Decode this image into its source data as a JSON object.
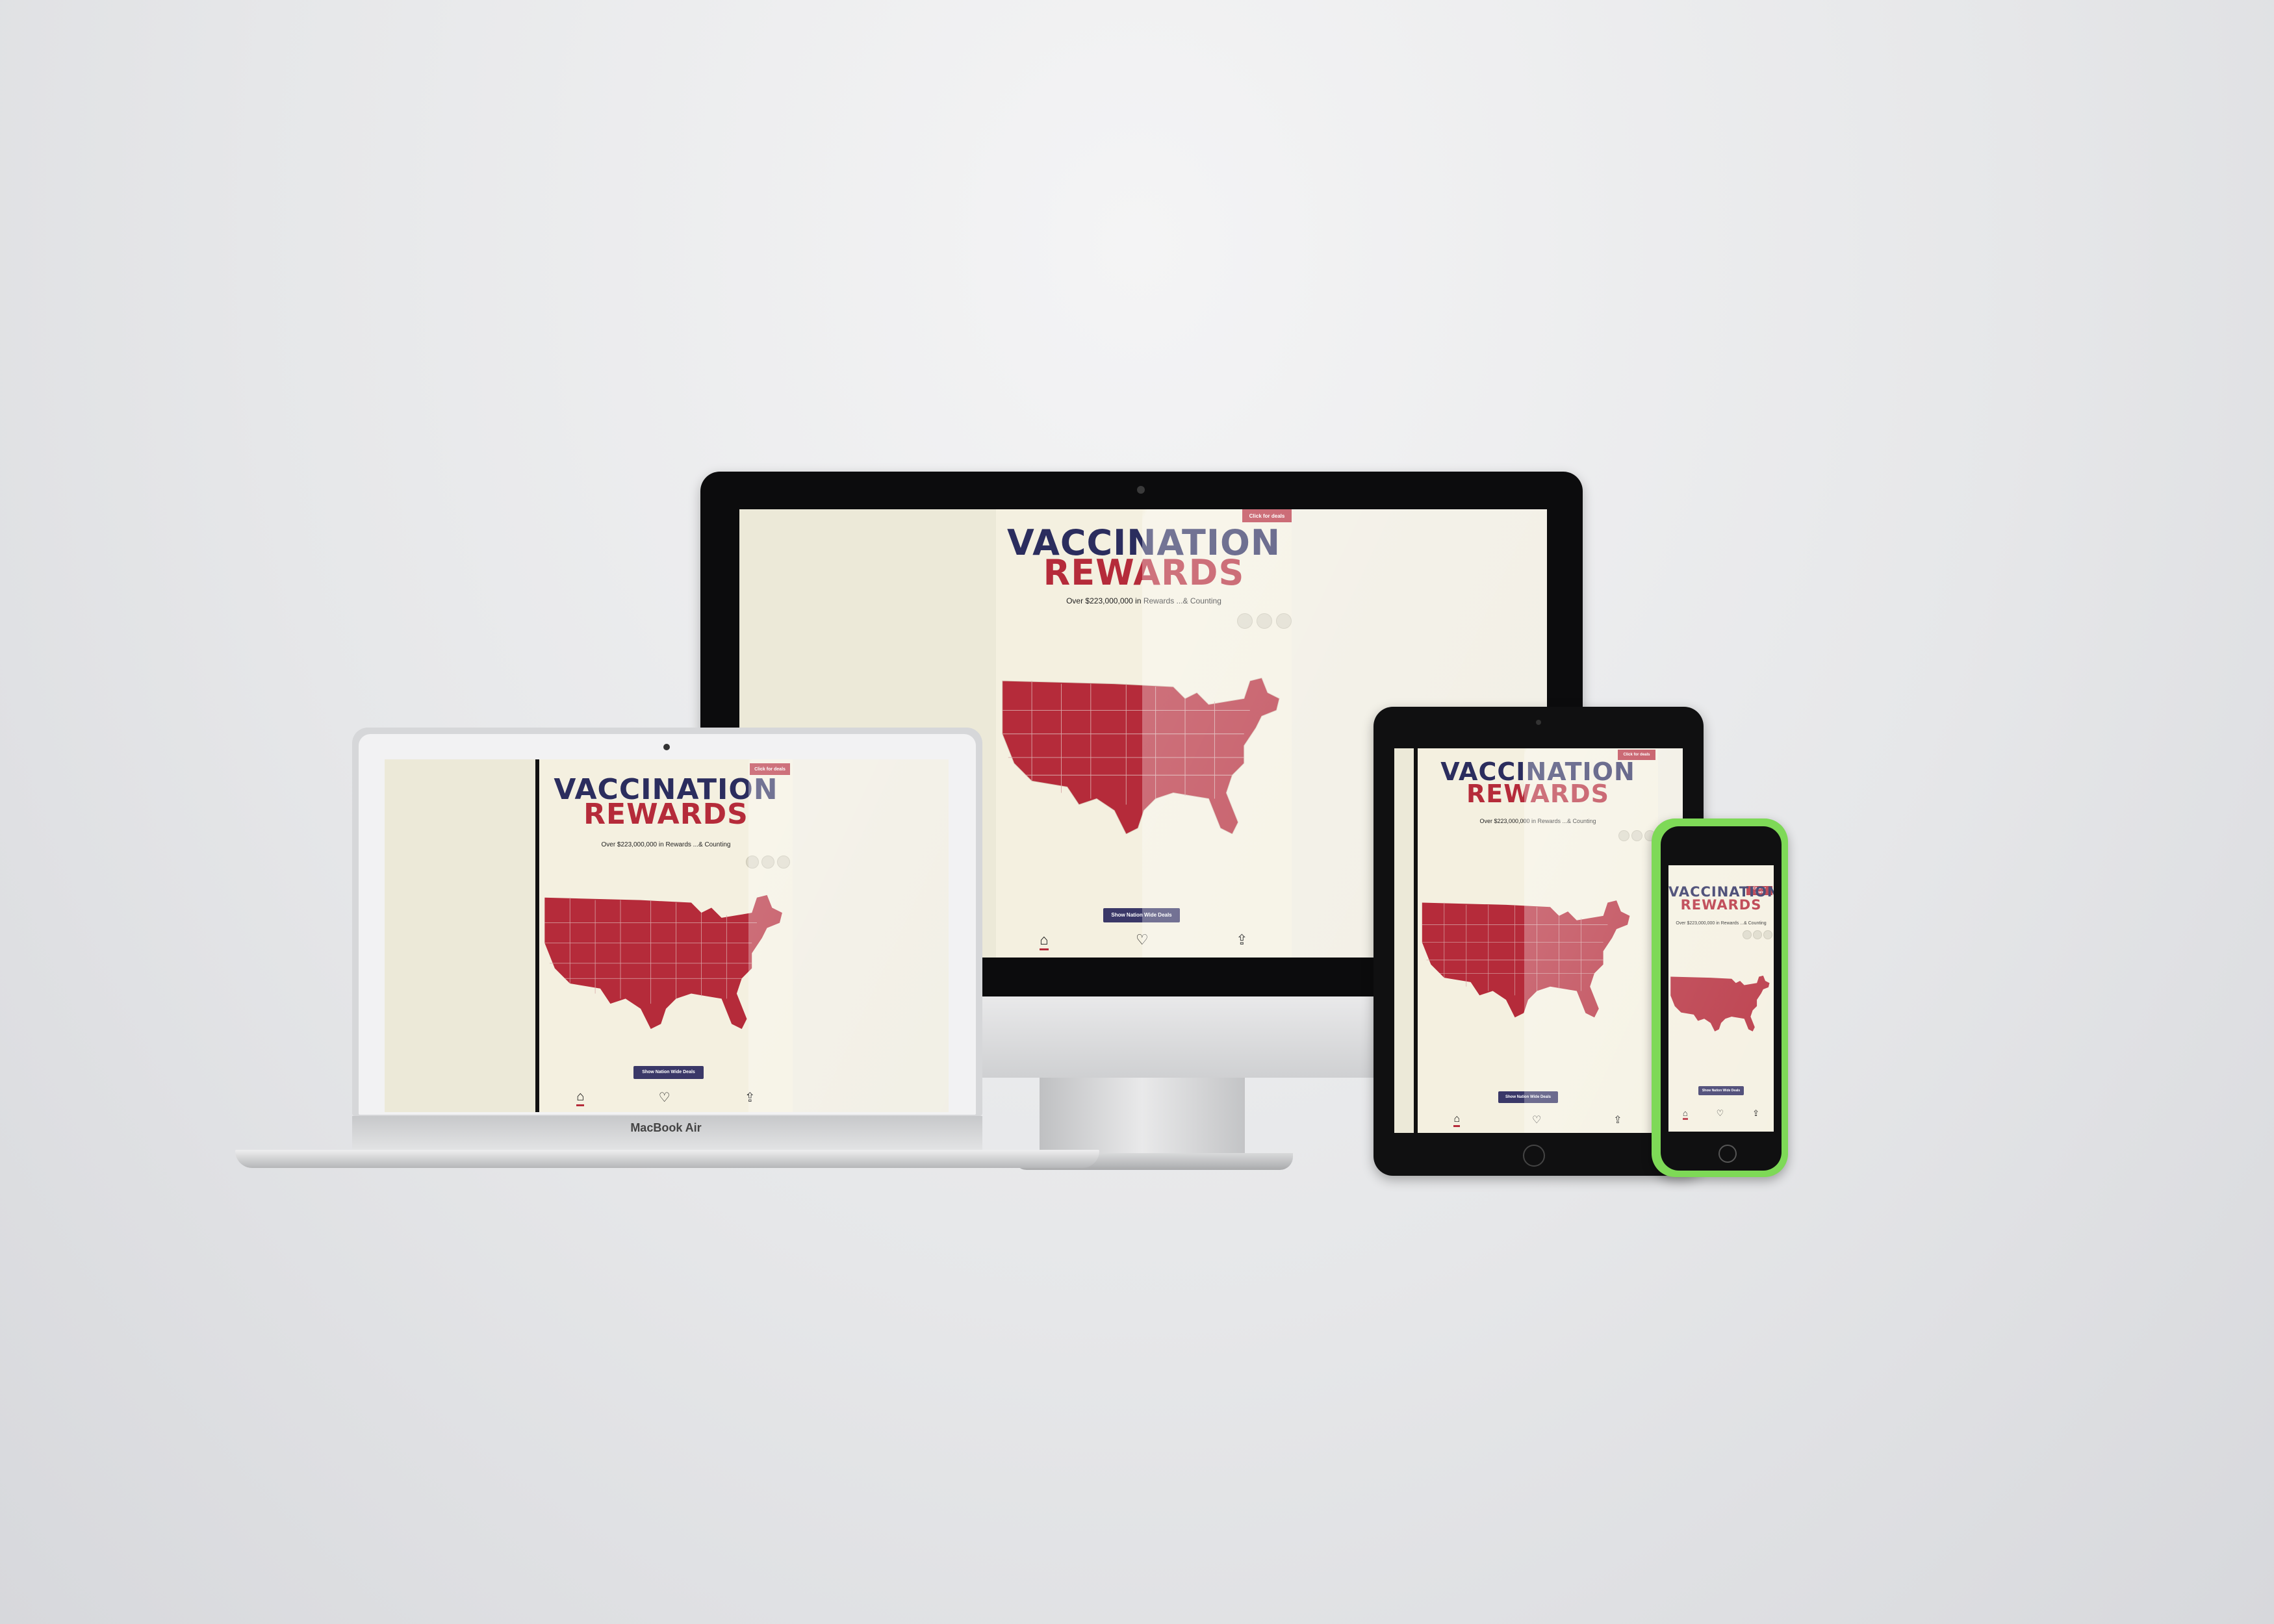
{
  "brand": {
    "title_line1": "VACCINATION",
    "title_line2": "REWARDS",
    "subtitle": "Over $223,000,000 in Rewards ...& Counting"
  },
  "header": {
    "deals_button": "Click for deals"
  },
  "main": {
    "nation_button": "Show Nation Wide Deals"
  },
  "nav": {
    "home_icon": "⌂",
    "heart_icon": "♡",
    "share_icon": "⇪"
  },
  "devices": {
    "laptop_label": "MacBook Air"
  },
  "colors": {
    "accent_red": "#b52b3a",
    "navy": "#2b2d5e",
    "background": "#f4f0e0"
  }
}
